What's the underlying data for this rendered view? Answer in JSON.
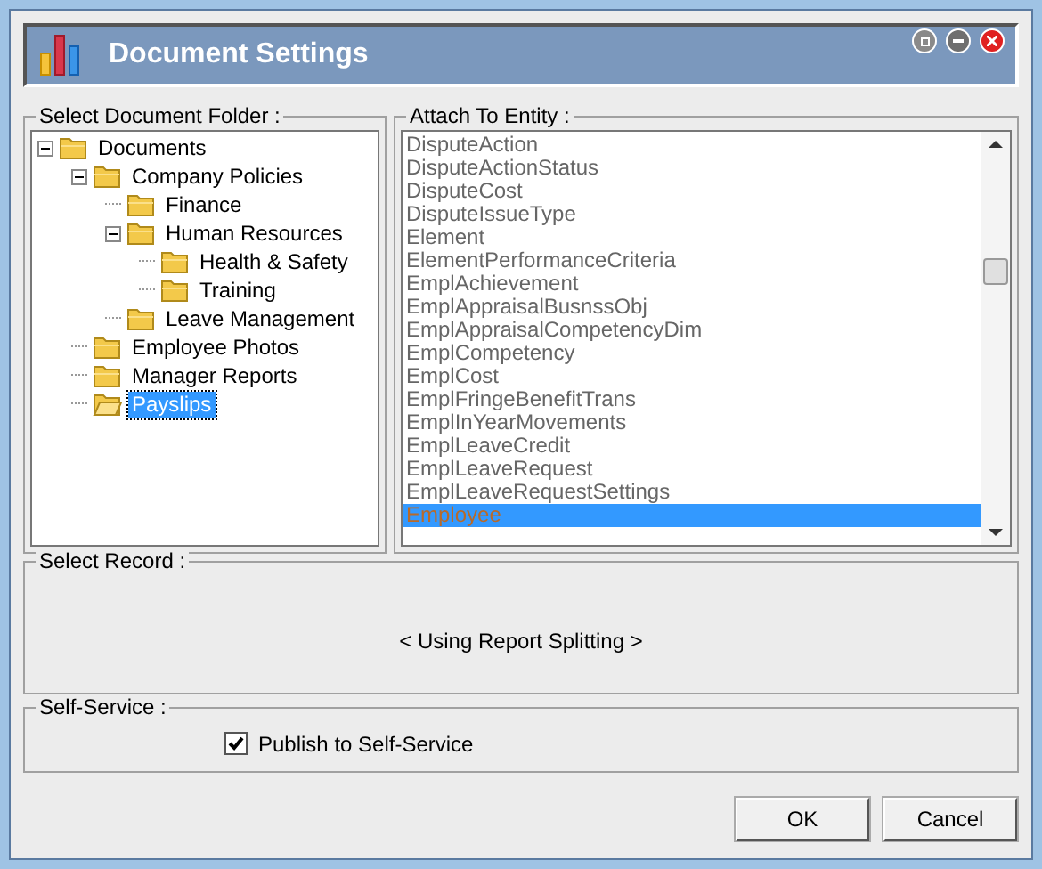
{
  "window": {
    "title": "Document Settings"
  },
  "folder_group": {
    "label": "Select Document Folder :",
    "tree": [
      {
        "label": "Documents",
        "expanded": true,
        "selected": false,
        "children": [
          {
            "label": "Company Policies",
            "expanded": true,
            "selected": false,
            "children": [
              {
                "label": "Finance",
                "selected": false
              },
              {
                "label": "Human Resources",
                "expanded": true,
                "selected": false,
                "children": [
                  {
                    "label": "Health & Safety",
                    "selected": false
                  },
                  {
                    "label": "Training",
                    "selected": false
                  }
                ]
              },
              {
                "label": "Leave Management",
                "selected": false
              }
            ]
          },
          {
            "label": "Employee Photos",
            "selected": false
          },
          {
            "label": "Manager Reports",
            "selected": false
          },
          {
            "label": "Payslips",
            "selected": true
          }
        ]
      }
    ]
  },
  "entity_group": {
    "label": "Attach To Entity :",
    "items": [
      {
        "label": "DisputeAction",
        "selected": false
      },
      {
        "label": "DisputeActionStatus",
        "selected": false
      },
      {
        "label": "DisputeCost",
        "selected": false
      },
      {
        "label": "DisputeIssueType",
        "selected": false
      },
      {
        "label": "Element",
        "selected": false
      },
      {
        "label": "ElementPerformanceCriteria",
        "selected": false
      },
      {
        "label": "EmplAchievement",
        "selected": false
      },
      {
        "label": "EmplAppraisalBusnssObj",
        "selected": false
      },
      {
        "label": "EmplAppraisalCompetencyDim",
        "selected": false
      },
      {
        "label": "EmplCompetency",
        "selected": false
      },
      {
        "label": "EmplCost",
        "selected": false
      },
      {
        "label": "EmplFringeBenefitTrans",
        "selected": false
      },
      {
        "label": "EmplInYearMovements",
        "selected": false
      },
      {
        "label": "EmplLeaveCredit",
        "selected": false
      },
      {
        "label": "EmplLeaveRequest",
        "selected": false
      },
      {
        "label": "EmplLeaveRequestSettings",
        "selected": false
      },
      {
        "label": "Employee",
        "selected": true
      }
    ]
  },
  "record_group": {
    "label": "Select Record :",
    "text": "< Using Report Splitting >"
  },
  "self_service_group": {
    "label": "Self-Service :",
    "checkbox": {
      "label": "Publish to Self-Service",
      "checked": true
    }
  },
  "buttons": [
    {
      "label": "OK"
    },
    {
      "label": "Cancel"
    }
  ]
}
